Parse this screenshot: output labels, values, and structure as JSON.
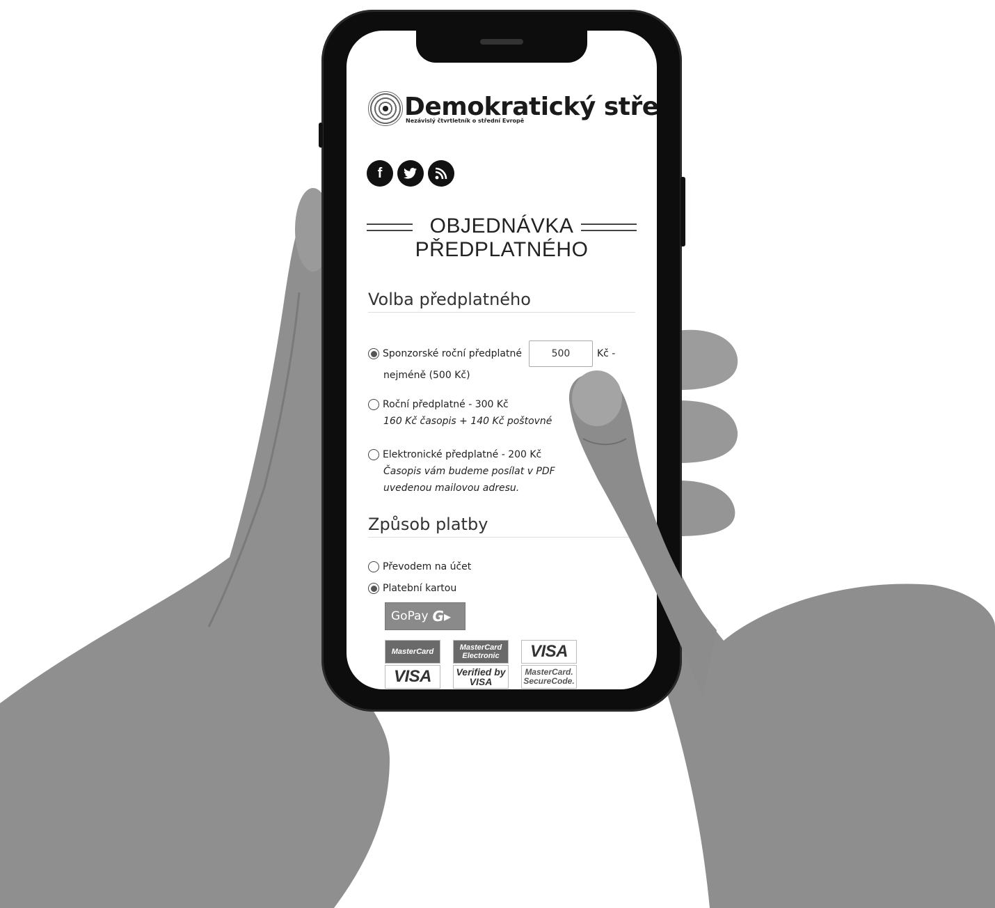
{
  "brand": {
    "name": "Demokratický střed",
    "tagline": "Nezávislý čtvrtletník o střední Evropě"
  },
  "social": {
    "facebook": "f",
    "twitter": "t",
    "rss": "rss"
  },
  "order_title": {
    "line1": "OBJEDNÁVKA",
    "line2": "PŘEDPLATNÉHO"
  },
  "subscription": {
    "heading": "Volba předplatného",
    "options": [
      {
        "label": "Sponzorské roční předplatné",
        "amount_value": "500",
        "unit": "Kč -",
        "note": "nejméně (500 Kč)",
        "selected": true
      },
      {
        "label": "Roční předplatné - 300 Kč",
        "note": "160 Kč časopis + 140 Kč poštovné",
        "selected": false
      },
      {
        "label": "Elektronické předplatné - 200 Kč",
        "note1": "Časopis vám budeme posílat v PDF",
        "note2": "uvedenou mailovou adresu.",
        "selected": false
      }
    ]
  },
  "payment": {
    "heading": "Způsob platby",
    "options": [
      {
        "label": "Převodem na účet",
        "selected": false
      },
      {
        "label": "Platební kartou",
        "selected": true
      }
    ],
    "gopay": {
      "text": "GoPay",
      "mark": "G▸"
    },
    "cards": [
      {
        "name": "mastercard-logo",
        "text": "MasterCard"
      },
      {
        "name": "mastercard-electronic-logo",
        "text": "MasterCard Electronic"
      },
      {
        "name": "visa-electron-logo",
        "text": "VISA"
      },
      {
        "name": "visa-logo",
        "text": "VISA"
      },
      {
        "name": "verified-by-visa-logo",
        "text": "Verified by VISA"
      },
      {
        "name": "mastercard-securecode-logo",
        "text": "MasterCard. SecureCode."
      }
    ]
  },
  "colors": {
    "skin": "#9a9a9a",
    "phone_body": "#0d0d0d",
    "screen_bg": "#ffffff"
  }
}
